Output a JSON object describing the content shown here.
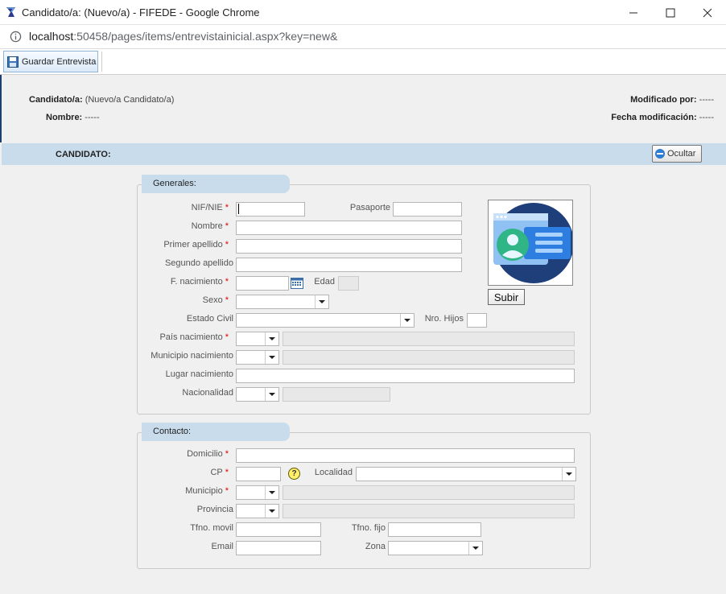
{
  "window": {
    "title": "Candidato/a: (Nuevo/a) - FIFEDE - Google Chrome",
    "url_host": "localhost",
    "url_rest": ":50458/pages/items/entrevistainicial.aspx?key=new&"
  },
  "toolbar": {
    "save_label": "Guardar Entrevista"
  },
  "header": {
    "candidato_label": "Candidato/a:",
    "candidato_value": "(Nuevo/a Candidato/a)",
    "nombre_label": "Nombre:",
    "nombre_value": "-----",
    "modificado_label": "Modificado por:",
    "modificado_value": "-----",
    "fecha_label": "Fecha modificación:",
    "fecha_value": "-----"
  },
  "section": {
    "title": "CANDIDATO:",
    "hide_label": "Ocultar"
  },
  "generales": {
    "legend": "Generales:",
    "nif": "NIF/NIE",
    "pasaporte": "Pasaporte",
    "nombre": "Nombre",
    "primer_apellido": "Primer apellido",
    "segundo_apellido": "Segundo apellido",
    "f_nacimiento": "F. nacimiento",
    "edad": "Edad",
    "sexo": "Sexo",
    "estado_civil": "Estado Civil",
    "nro_hijos": "Nro. Hijos",
    "pais_nacimiento": "País nacimiento",
    "municipio_nacimiento": "Municipio nacimiento",
    "lugar_nacimiento": "Lugar nacimiento",
    "nacionalidad": "Nacionalidad",
    "subir": "Subir"
  },
  "contacto": {
    "legend": "Contacto:",
    "domicilio": "Domicilio",
    "cp": "CP",
    "localidad": "Localidad",
    "municipio": "Municipio",
    "provincia": "Provincia",
    "tfno_movil": "Tfno. movil",
    "tfno_fijo": "Tfno. fijo",
    "email": "Email",
    "zona": "Zona",
    "help_glyph": "?"
  },
  "required_mark": "*",
  "colors": {
    "section_bg": "#c9dcec",
    "required": "#dd0000"
  },
  "icons": [
    "chrome-app-icon",
    "minimize-icon",
    "maximize-icon",
    "close-icon",
    "info-icon",
    "save-icon",
    "minus-circle-icon",
    "calendar-icon",
    "help-icon",
    "profile-photo-placeholder-icon"
  ]
}
